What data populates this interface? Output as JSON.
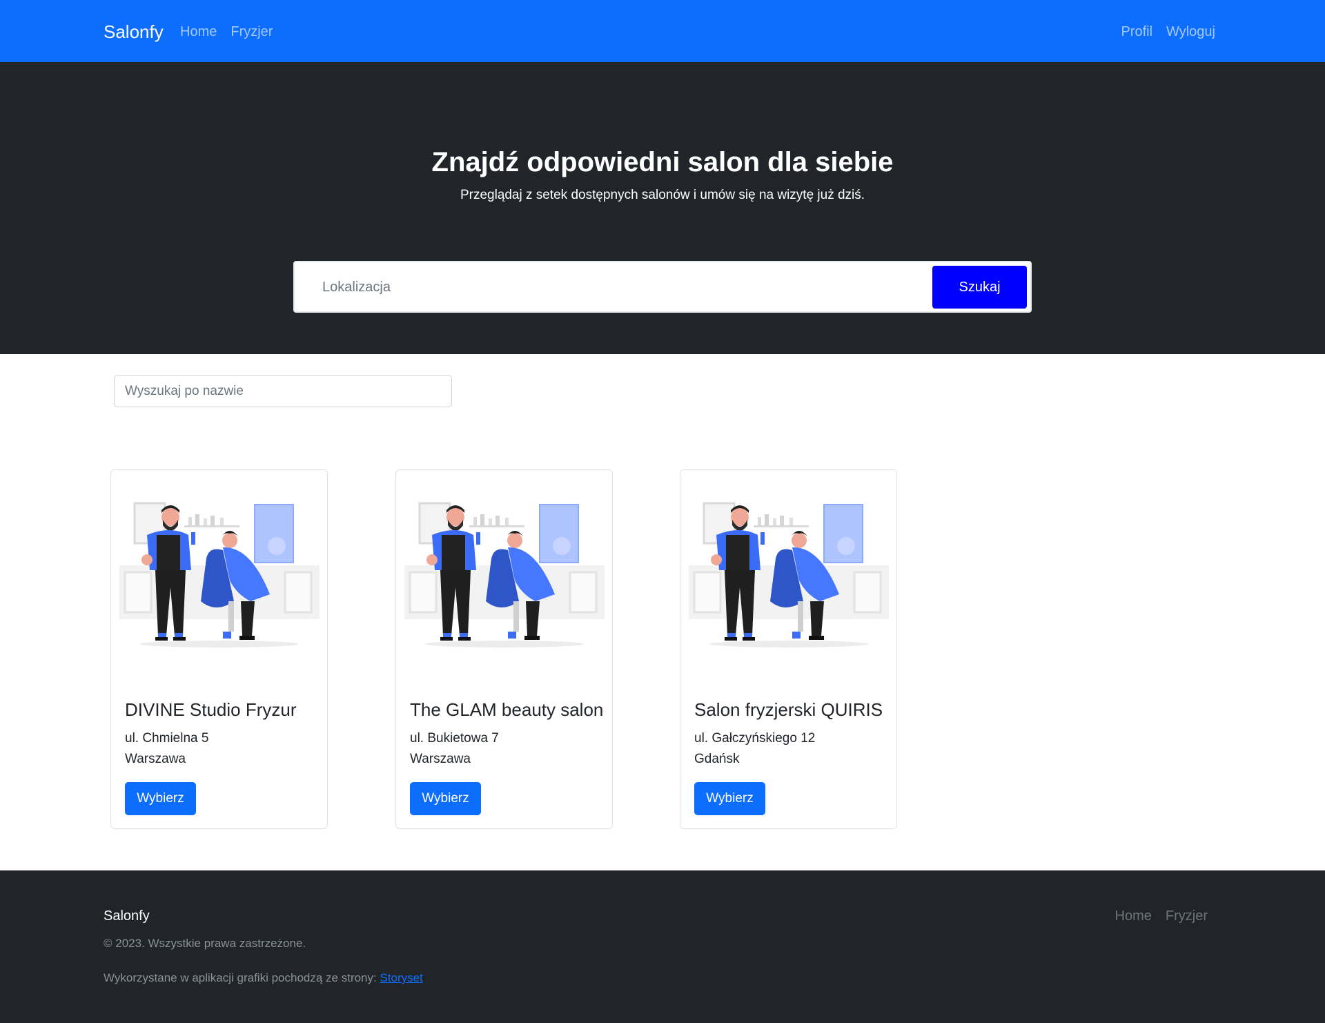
{
  "navbar": {
    "brand": "Salonfy",
    "left_links": [
      "Home",
      "Fryzjer"
    ],
    "right_links": [
      "Profil",
      "Wyloguj"
    ],
    "bg_color": "#0d6efd"
  },
  "hero": {
    "title": "Znajdź odpowiedni salon dla siebie",
    "subtitle": "Przeglądaj z setek dostępnych salonów i umów się na wizytę już dziś.",
    "location_placeholder": "Lokalizacja",
    "search_label": "Szukaj"
  },
  "filter": {
    "name_placeholder": "Wyszukaj po nazwie"
  },
  "salons": [
    {
      "name": "DIVINE Studio Fryzur",
      "street": "ul. Chmielna 5",
      "city": "Warszawa",
      "button": "Wybierz",
      "image_icon": "barber-illustration"
    },
    {
      "name": "The GLAM beauty salon",
      "street": "ul. Bukietowa 7",
      "city": "Warszawa",
      "button": "Wybierz",
      "image_icon": "barber-illustration"
    },
    {
      "name": "Salon fryzjerski QUIRIS",
      "street": "ul. Gałczyńskiego 12",
      "city": "Gdańsk",
      "button": "Wybierz",
      "image_icon": "barber-illustration"
    }
  ],
  "footer": {
    "brand": "Salonfy",
    "copyright": "© 2023. Wszystkie prawa zastrzeżone.",
    "credit_text": "Wykorzystane w aplikacji grafiki pochodzą ze strony: ",
    "credit_link": "Storyset",
    "links": [
      "Home",
      "Fryzjer"
    ]
  }
}
